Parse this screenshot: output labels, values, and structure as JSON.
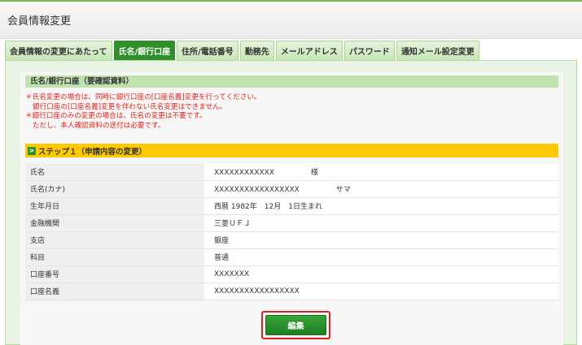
{
  "header": {
    "title": "会員情報変更"
  },
  "tabs": [
    {
      "label": "会員情報の変更にあたって"
    },
    {
      "label": "氏名/銀行口座"
    },
    {
      "label": "住所/電話番号"
    },
    {
      "label": "勤務先"
    },
    {
      "label": "メールアドレス"
    },
    {
      "label": "パスワード"
    },
    {
      "label": "通知メール設定変更"
    }
  ],
  "active_tab": "氏名/銀行口座",
  "section": {
    "title": "氏名/銀行口座（要確認資料）"
  },
  "notes": [
    "＊氏名変更の場合は、同時に銀行口座の[口座名義]変更を行ってください。",
    "銀行口座の[口座名義]変更を伴わない氏名変更はできません。",
    "＊銀行口座のみの変更の場合は、氏名の変更は不要です。",
    "ただし、本人確認資料の送付は必要です。"
  ],
  "step": {
    "icon": "arrow-right-icon",
    "label": "ステップ１（申請内容の変更）"
  },
  "rows": [
    {
      "label": "氏名",
      "value": "XXXXXXXXXXXX",
      "suffix": "様"
    },
    {
      "label": "氏名(カナ)",
      "value": "XXXXXXXXXXXXXXXXX",
      "suffix": "サマ"
    },
    {
      "label": "生年月日",
      "value": "西暦 1982年　12月　1日生まれ",
      "suffix": ""
    },
    {
      "label": "金融機関",
      "value": "三菱ＵＦＪ",
      "suffix": ""
    },
    {
      "label": "支店",
      "value": "銀座",
      "suffix": ""
    },
    {
      "label": "科目",
      "value": "普通",
      "suffix": ""
    },
    {
      "label": "口座番号",
      "value": "XXXXXXX",
      "suffix": ""
    },
    {
      "label": "口座名義",
      "value": "XXXXXXXXXXXXXXXXX",
      "suffix": ""
    }
  ],
  "edit_button": {
    "label": "編集"
  },
  "colors": {
    "accent_green": "#2f8f2a",
    "step_yellow": "#ffc800",
    "note_red": "#e0221a",
    "highlight_red": "#e02020"
  }
}
